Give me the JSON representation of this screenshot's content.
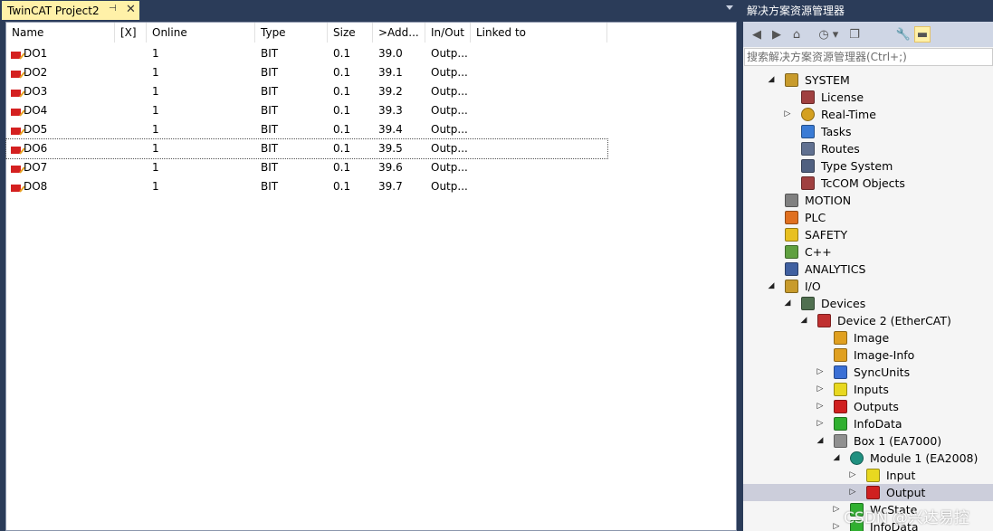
{
  "editor": {
    "tab_title": "TwinCAT Project2",
    "pin_glyph": "⊣",
    "close_glyph": "✕",
    "columns": [
      "Name",
      "[X]",
      "Online",
      "Type",
      "Size",
      ">Add...",
      "In/Out",
      "Linked to"
    ],
    "rows": [
      {
        "name": "DO1",
        "x": "",
        "online": "1",
        "type": "BIT",
        "size": "0.1",
        "addr": "39.0",
        "inout": "Outp...",
        "linked": ""
      },
      {
        "name": "DO2",
        "x": "",
        "online": "1",
        "type": "BIT",
        "size": "0.1",
        "addr": "39.1",
        "inout": "Outp...",
        "linked": ""
      },
      {
        "name": "DO3",
        "x": "",
        "online": "1",
        "type": "BIT",
        "size": "0.1",
        "addr": "39.2",
        "inout": "Outp...",
        "linked": ""
      },
      {
        "name": "DO4",
        "x": "",
        "online": "1",
        "type": "BIT",
        "size": "0.1",
        "addr": "39.3",
        "inout": "Outp...",
        "linked": ""
      },
      {
        "name": "DO5",
        "x": "",
        "online": "1",
        "type": "BIT",
        "size": "0.1",
        "addr": "39.4",
        "inout": "Outp...",
        "linked": ""
      },
      {
        "name": "DO6",
        "x": "",
        "online": "1",
        "type": "BIT",
        "size": "0.1",
        "addr": "39.5",
        "inout": "Outp...",
        "linked": ""
      },
      {
        "name": "DO7",
        "x": "",
        "online": "1",
        "type": "BIT",
        "size": "0.1",
        "addr": "39.6",
        "inout": "Outp...",
        "linked": ""
      },
      {
        "name": "DO8",
        "x": "",
        "online": "1",
        "type": "BIT",
        "size": "0.1",
        "addr": "39.7",
        "inout": "Outp...",
        "linked": ""
      }
    ],
    "selected_row": "DO6"
  },
  "solution_explorer": {
    "title": "解决方案资源管理器",
    "search_placeholder": "搜索解决方案资源管理器(Ctrl+;)",
    "toolbar_icons": [
      "back-icon",
      "forward-icon",
      "home-icon",
      "history-icon",
      "dropdown-icon",
      "copy-windows-icon",
      "wrench-icon",
      "pin-icon"
    ],
    "tree": [
      {
        "label": "SYSTEM",
        "level": 0,
        "expander": "open",
        "icon": "system-icon",
        "color": "#c89b2c"
      },
      {
        "label": "License",
        "level": 1,
        "expander": "none",
        "icon": "license-icon",
        "color": "#a04040"
      },
      {
        "label": "Real-Time",
        "level": 1,
        "expander": "closed",
        "icon": "realtime-icon",
        "color": "#d4a020"
      },
      {
        "label": "Tasks",
        "level": 1,
        "expander": "none",
        "icon": "tasks-icon",
        "color": "#3a7bd5"
      },
      {
        "label": "Routes",
        "level": 1,
        "expander": "none",
        "icon": "routes-icon",
        "color": "#607090"
      },
      {
        "label": "Type System",
        "level": 1,
        "expander": "none",
        "icon": "type-system-icon",
        "color": "#506080"
      },
      {
        "label": "TcCOM Objects",
        "level": 1,
        "expander": "none",
        "icon": "tccom-icon",
        "color": "#a04040"
      },
      {
        "label": "MOTION",
        "level": 0,
        "expander": "none",
        "icon": "motion-icon",
        "color": "#808080"
      },
      {
        "label": "PLC",
        "level": 0,
        "expander": "none",
        "icon": "plc-icon",
        "color": "#e07020"
      },
      {
        "label": "SAFETY",
        "level": 0,
        "expander": "none",
        "icon": "safety-icon",
        "color": "#e8c020"
      },
      {
        "label": "C++",
        "level": 0,
        "expander": "none",
        "icon": "cpp-icon",
        "color": "#60a040"
      },
      {
        "label": "ANALYTICS",
        "level": 0,
        "expander": "none",
        "icon": "analytics-icon",
        "color": "#4060a0"
      },
      {
        "label": "I/O",
        "level": 0,
        "expander": "open",
        "icon": "io-icon",
        "color": "#c89b2c"
      },
      {
        "label": "Devices",
        "level": 1,
        "expander": "open",
        "icon": "devices-icon",
        "color": "#507050"
      },
      {
        "label": "Device 2 (EtherCAT)",
        "level": 2,
        "expander": "open",
        "icon": "ethercat-icon",
        "color": "#c03030"
      },
      {
        "label": "Image",
        "level": 3,
        "expander": "none",
        "icon": "image-icon",
        "color": "#e0a020"
      },
      {
        "label": "Image-Info",
        "level": 3,
        "expander": "none",
        "icon": "image-info-icon",
        "color": "#e0a020"
      },
      {
        "label": "SyncUnits",
        "level": 3,
        "expander": "closed",
        "icon": "syncunits-icon",
        "color": "#3a6fd5"
      },
      {
        "label": "Inputs",
        "level": 3,
        "expander": "closed",
        "icon": "inputs-icon",
        "color": "#e8d820"
      },
      {
        "label": "Outputs",
        "level": 3,
        "expander": "closed",
        "icon": "outputs-icon",
        "color": "#d02020"
      },
      {
        "label": "InfoData",
        "level": 3,
        "expander": "closed",
        "icon": "infodata-icon",
        "color": "#30b030"
      },
      {
        "label": "Box 1 (EA7000)",
        "level": 3,
        "expander": "open",
        "icon": "box-icon",
        "color": "#909090"
      },
      {
        "label": "Module 1 (EA2008)",
        "level": 4,
        "expander": "open",
        "icon": "module-icon",
        "color": "#209080"
      },
      {
        "label": "Input",
        "level": 5,
        "expander": "closed",
        "icon": "input-icon",
        "color": "#e8d820"
      },
      {
        "label": "Output",
        "level": 5,
        "expander": "closed",
        "icon": "output-icon",
        "color": "#d02020",
        "selected": true
      },
      {
        "label": "WcState",
        "level": 4,
        "expander": "closed",
        "icon": "wcstate-icon",
        "color": "#30b030"
      },
      {
        "label": "InfoData",
        "level": 4,
        "expander": "closed",
        "icon": "infodata-icon",
        "color": "#30b030"
      }
    ]
  },
  "watermark": "CSDN @兴达易控"
}
